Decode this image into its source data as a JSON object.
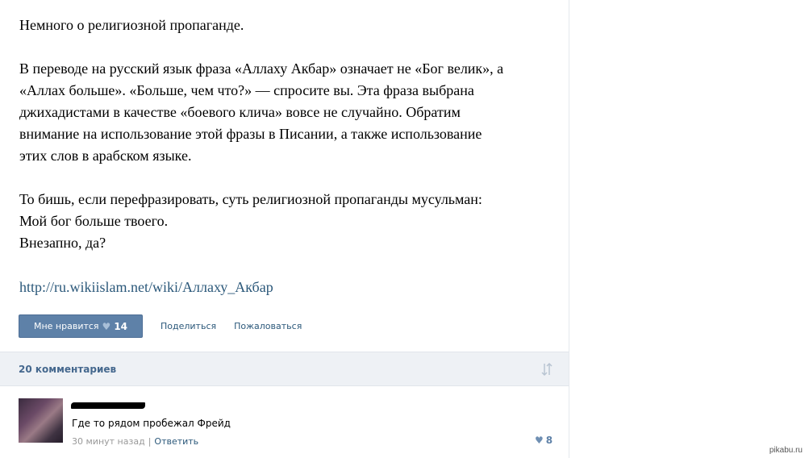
{
  "post": {
    "paragraphs": [
      [
        "Немного о религиозной пропаганде."
      ],
      [
        "В переводе на русский язык фраза «Аллаху Акбар» означает не «Бог велик», а",
        "«Аллах больше». «Больше, чем что?» — спросите вы. Эта фраза выбрана",
        "джихадистами в качестве «боевого клича» вовсе не случайно. Обратим",
        "внимание на использование этой фразы в Писании, а также использование",
        "этих слов в арабском языке."
      ],
      [
        "То бишь, если перефразировать, суть религиозной пропаганды мусульман:",
        "Мой бог больше твоего.",
        "Внезапно, да?"
      ]
    ],
    "link": "http://ru.wikiislam.net/wiki/Аллаху_Акбар"
  },
  "actions": {
    "like_label": "Мне нравится",
    "like_count": "14",
    "share_label": "Поделиться",
    "report_label": "Пожаловаться"
  },
  "comments": {
    "count_label": "20 комментариев",
    "items": [
      {
        "text": "Где то рядом пробежал Фрейд",
        "time": "30 минут назад",
        "reply_label": "Ответить",
        "likes": "8"
      }
    ]
  },
  "watermark": "pikabu.ru",
  "colors": {
    "accent": "#5e81a8",
    "link": "#2b587a",
    "bar": "#eef1f5"
  }
}
